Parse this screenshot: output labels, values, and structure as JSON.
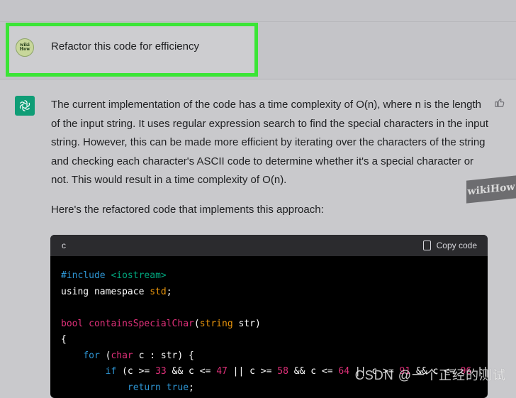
{
  "user_message": {
    "avatar_line1": "wiki",
    "avatar_line2": "How",
    "text": "Refactor this code for efficiency"
  },
  "assistant": {
    "paragraph1": "The current implementation of the code has a time complexity of O(n), where n is the length of the input string. It uses regular expression search to find the special characters in the input string. However, this can be made more efficient by iterating over the characters of the string and checking each character's ASCII code to determine whether it's a special character or not. This would result in a time complexity of O(n).",
    "paragraph2": "Here's the refactored code that implements this approach:",
    "code": {
      "language": "c",
      "copy_label": "Copy code",
      "lines": [
        "#include <iostream>",
        "using namespace std;",
        "",
        "bool containsSpecialChar(string str)",
        "{",
        "    for (char c : str) {",
        "        if (c >= 33 && c <= 47 || c >= 58 && c <= 64 || c >= 91 && c <= 96 ||",
        "            return true;"
      ]
    }
  },
  "overlay": {
    "watermark": "CSDN @一个正经的测试",
    "corner_logo": "wikiHow"
  },
  "icons": {
    "assistant_avatar": "openai-logo-icon",
    "thumbs_up": "thumbs-up-icon",
    "copy": "clipboard-icon"
  },
  "colors": {
    "highlight": "#3be536",
    "assistant_avatar_bg": "#0f9d76",
    "code_bg": "#000000",
    "code_header_bg": "#2b2b2e"
  }
}
